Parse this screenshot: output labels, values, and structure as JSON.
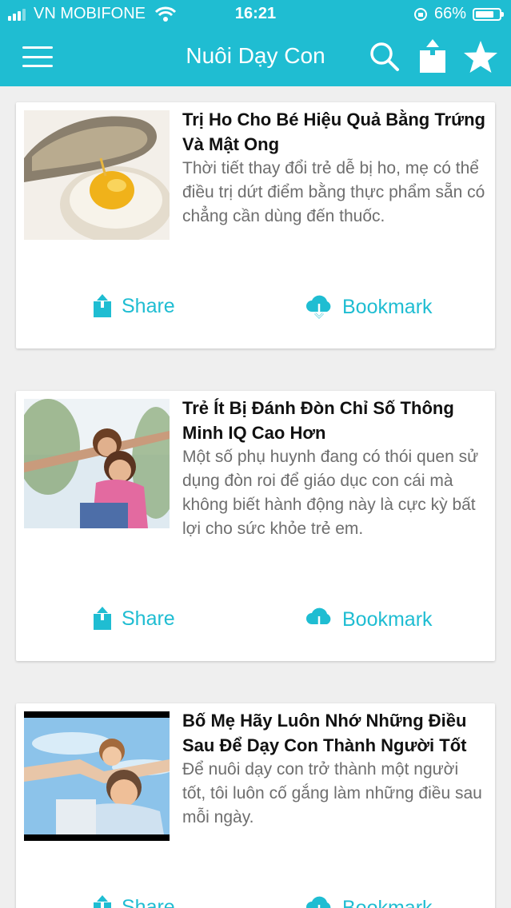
{
  "status_bar": {
    "carrier": "VN MOBIFONE",
    "time": "16:21",
    "battery": "66%"
  },
  "nav": {
    "title": "Nuôi Dạy Con"
  },
  "articles": [
    {
      "title": "Trị Ho Cho Bé Hiệu Quả Bằng Trứng Và Mật Ong",
      "description": "Thời tiết thay đổi trẻ dễ bị ho, mẹ có thể điều trị dứt điểm bằng thực phẩm sẵn có chẳng cần dùng đến thuốc.",
      "thumbnail": "egg-honey-photo"
    },
    {
      "title": "Trẻ Ít Bị Đánh Đòn Chỉ Số Thông Minh IQ Cao Hơn",
      "description": "Một số phụ huynh đang có thói quen sử dụng đòn roi để giáo dục con cái mà không biết hành động này là cực kỳ bất lợi cho sức khỏe trẻ em.",
      "thumbnail": "mother-daughter-photo"
    },
    {
      "title": "Bố Mẹ Hãy Luôn Nhớ Những Điều Sau Để Dạy Con Thành Người Tốt",
      "description": "Để nuôi dạy con trở thành một người tốt, tôi luôn cố gắng làm những điều sau mỗi ngày.",
      "thumbnail": "father-child-photo"
    }
  ],
  "actions": {
    "share_label": "Share",
    "bookmark_label": "Bookmark"
  },
  "colors": {
    "accent": "#1fbdd2",
    "background": "#efefef"
  }
}
